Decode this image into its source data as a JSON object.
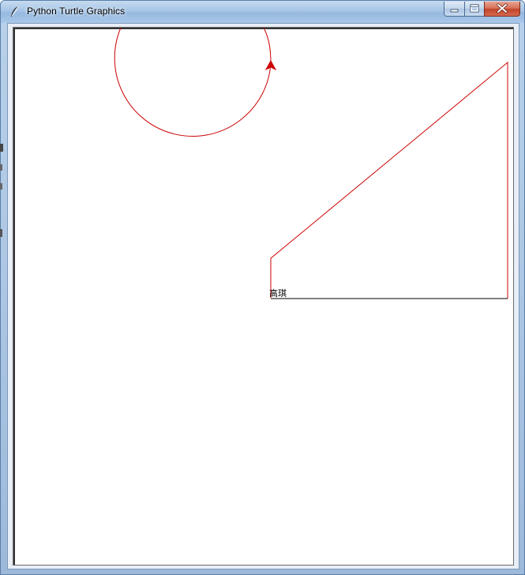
{
  "window": {
    "title": "Python Turtle Graphics",
    "title_icon": "feather-icon",
    "controls": {
      "minimize_icon": "minimize-icon",
      "maximize_icon": "maximize-icon",
      "close_icon": "close-icon"
    }
  },
  "canvas": {
    "background": "#ffffff",
    "pen_color": "#cc0000",
    "text_color": "#000000",
    "label_text": "高琪"
  }
}
